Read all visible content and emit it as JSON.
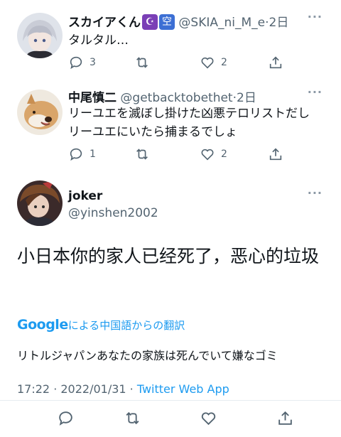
{
  "replies": [
    {
      "display_name": "スカイアくん",
      "badges": [
        "☪",
        "空"
      ],
      "handle": "@SKIA_ni_M_e",
      "time": "·2日",
      "text_lines": [
        "タルタル…"
      ],
      "reply_count": "3",
      "retweet_count": "",
      "like_count": "2"
    },
    {
      "display_name": "中尾慎二",
      "handle": "@getbacktobethet",
      "time": "·2日",
      "text_lines": [
        "リーユエを滅ぼし掛けた凶悪テロリストだし",
        "リーユエにいたら捕まるでしょ"
      ],
      "reply_count": "1",
      "retweet_count": "",
      "like_count": "2"
    }
  ],
  "main_tweet": {
    "display_name": "joker",
    "handle": "@yinshen2002",
    "text": "小日本你的家人已经死了，恶心的垃圾",
    "translate_brand": "Google",
    "translate_label": "による中国語からの翻訳",
    "translated_text": "リトルジャパンあなたの家族は死んでいて嫌なゴミ",
    "timestamp": "17:22 · 2022/01/31 · ",
    "source": "Twitter Web App"
  },
  "more_label": "···",
  "icons": [
    "reply-icon",
    "retweet-icon",
    "like-icon",
    "share-icon",
    "more-icon"
  ],
  "colors": {
    "link": "#1d9bf0",
    "secondary": "#536471",
    "text": "#0f1419"
  }
}
